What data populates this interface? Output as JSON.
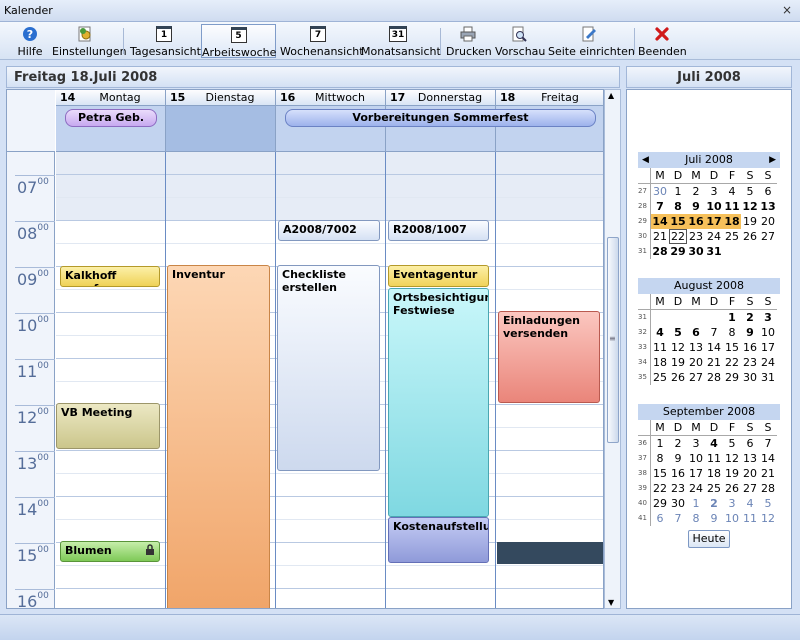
{
  "window": {
    "title": "Kalender",
    "close_glyph": "×"
  },
  "toolbar": {
    "items": [
      {
        "label": "Hilfe",
        "icon": "help-icon"
      },
      {
        "label": "Einstellungen",
        "icon": "settings-icon"
      },
      {
        "label": "Tagesansicht",
        "icon": "calendar-day-icon",
        "num": "1"
      },
      {
        "label": "Arbeitswoche",
        "icon": "calendar-workweek-icon",
        "num": "5"
      },
      {
        "label": "Wochenansicht",
        "icon": "calendar-week-icon",
        "num": "7"
      },
      {
        "label": "Monatsansicht",
        "icon": "calendar-month-icon",
        "num": "31"
      },
      {
        "label": "Drucken",
        "icon": "printer-icon"
      },
      {
        "label": "Vorschau",
        "icon": "preview-icon"
      },
      {
        "label": "Seite einrichten",
        "icon": "page-setup-icon"
      },
      {
        "label": "Beenden",
        "icon": "close-red-icon"
      }
    ]
  },
  "main": {
    "date_title": "Freitag 18.Juli 2008",
    "days": [
      {
        "num": "14",
        "name": "Montag"
      },
      {
        "num": "15",
        "name": "Dienstag"
      },
      {
        "num": "16",
        "name": "Mittwoch"
      },
      {
        "num": "17",
        "name": "Donnerstag"
      },
      {
        "num": "18",
        "name": "Freitag"
      }
    ],
    "hours": [
      {
        "h": "07",
        "m": "00"
      },
      {
        "h": "08",
        "m": "00"
      },
      {
        "h": "09",
        "m": "00"
      },
      {
        "h": "10",
        "m": "00"
      },
      {
        "h": "11",
        "m": "00"
      },
      {
        "h": "12",
        "m": "00"
      },
      {
        "h": "13",
        "m": "00"
      },
      {
        "h": "14",
        "m": "00"
      },
      {
        "h": "15",
        "m": "00"
      },
      {
        "h": "16",
        "m": "00"
      }
    ],
    "allday_events": [
      {
        "title": "Petra Geb.",
        "recurring_icon": "recurrence-icon"
      },
      {
        "title": "Vorbereitungen Sommerfest"
      }
    ],
    "events": {
      "kalkhoff": "Kalkhoff anrufen",
      "vb": "VB Meeting",
      "blumen": "Blumen",
      "inventur": "Inventur",
      "a2008": "A2008/7002",
      "checkliste": "Checkliste erstellen",
      "r2008": "R2008/1007",
      "eventagentur": "Eventagentur",
      "ortsbesichtigung": "Ortsbesichtigung Festwiese",
      "kosten": "Kostenaufstellung",
      "einladungen": "Einladungen versenden"
    },
    "colors": {
      "inventur": "#f3a76a",
      "checkliste": "#d6e2f4",
      "ortsbesichtigung": "#8fe3ea",
      "einladungen": "#ef8f84",
      "kalkhoff": "#f7e27a",
      "vb": "#dcd6a3",
      "blumen": "#9fd67b",
      "kosten": "#9fa9e0",
      "selection": "#34495e"
    }
  },
  "sidebar": {
    "title": "Juli 2008",
    "weekday_headers": [
      "M",
      "D",
      "M",
      "D",
      "F",
      "S",
      "S"
    ],
    "months": [
      {
        "name": "Juli 2008",
        "prev": "◀",
        "next": "▶",
        "rows": [
          {
            "wk": "27",
            "days": [
              "30",
              "1",
              "2",
              "3",
              "4",
              "5",
              "6"
            ]
          },
          {
            "wk": "28",
            "days": [
              "7",
              "8",
              "9",
              "10",
              "11",
              "12",
              "13"
            ]
          },
          {
            "wk": "29",
            "days": [
              "14",
              "15",
              "16",
              "17",
              "18",
              "19",
              "20"
            ]
          },
          {
            "wk": "30",
            "days": [
              "21",
              "22",
              "23",
              "24",
              "25",
              "26",
              "27"
            ]
          },
          {
            "wk": "31",
            "days": [
              "28",
              "29",
              "30",
              "31",
              "",
              "",
              ""
            ]
          }
        ]
      },
      {
        "name": "August 2008",
        "rows": [
          {
            "wk": "31",
            "days": [
              "",
              "",
              "",
              "",
              "1",
              "2",
              "3"
            ]
          },
          {
            "wk": "32",
            "days": [
              "4",
              "5",
              "6",
              "7",
              "8",
              "9",
              "10"
            ]
          },
          {
            "wk": "33",
            "days": [
              "11",
              "12",
              "13",
              "14",
              "15",
              "16",
              "17"
            ]
          },
          {
            "wk": "34",
            "days": [
              "18",
              "19",
              "20",
              "21",
              "22",
              "23",
              "24"
            ]
          },
          {
            "wk": "35",
            "days": [
              "25",
              "26",
              "27",
              "28",
              "29",
              "30",
              "31"
            ]
          }
        ]
      },
      {
        "name": "September 2008",
        "rows": [
          {
            "wk": "36",
            "days": [
              "1",
              "2",
              "3",
              "4",
              "5",
              "6",
              "7"
            ]
          },
          {
            "wk": "37",
            "days": [
              "8",
              "9",
              "10",
              "11",
              "12",
              "13",
              "14"
            ]
          },
          {
            "wk": "38",
            "days": [
              "15",
              "16",
              "17",
              "18",
              "19",
              "20",
              "21"
            ]
          },
          {
            "wk": "39",
            "days": [
              "22",
              "23",
              "24",
              "25",
              "26",
              "27",
              "28"
            ]
          },
          {
            "wk": "40",
            "days": [
              "29",
              "30",
              "1",
              "2",
              "3",
              "4",
              "5"
            ]
          },
          {
            "wk": "41",
            "days": [
              "6",
              "7",
              "8",
              "9",
              "10",
              "11",
              "12"
            ]
          }
        ]
      }
    ],
    "today_button": "Heute"
  }
}
